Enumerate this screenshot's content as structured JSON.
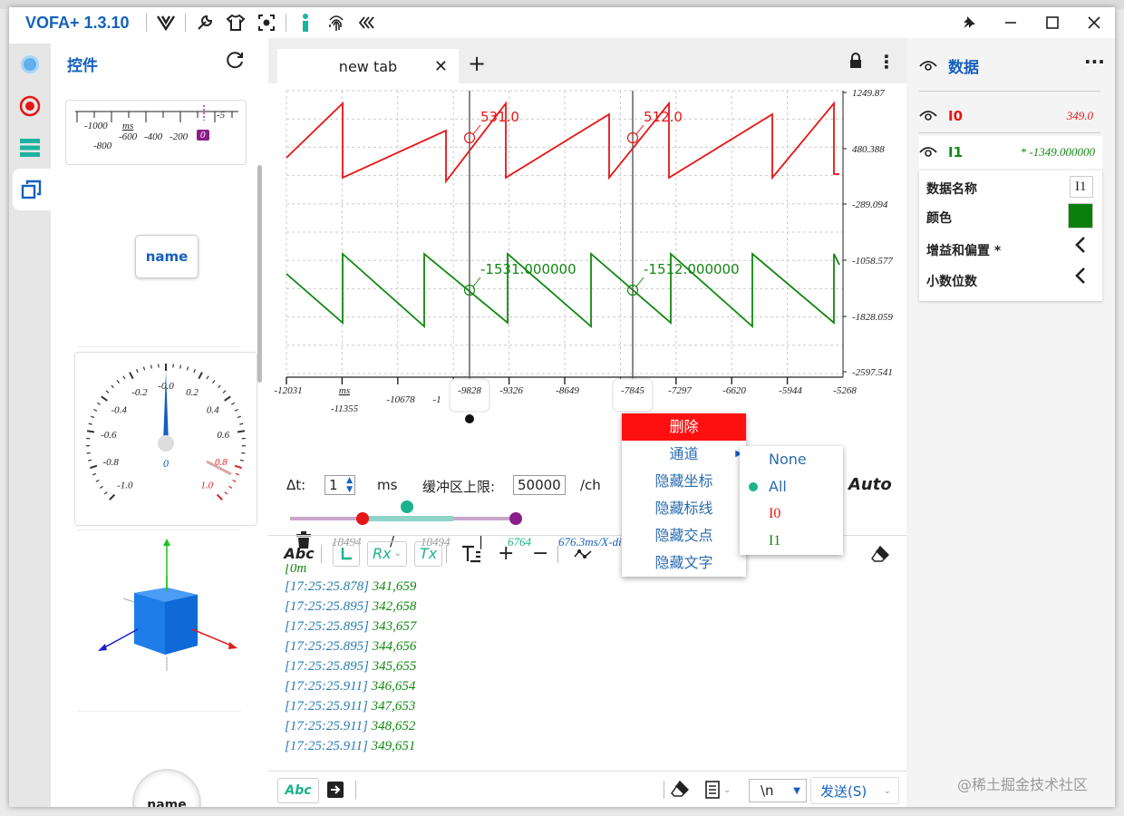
{
  "app": {
    "title": "VOFA+ 1.3.10"
  },
  "widgets": {
    "header": "控件",
    "name_button": "name",
    "name_knob": "name",
    "ruler_ticks": [
      "-1000",
      "-800",
      "-600",
      "-400",
      "-200"
    ],
    "ruler_unit": "ms",
    "ruler_edge": "-5",
    "ruler_badge": "0",
    "gauge_labels": [
      "-1.0",
      "-0.8",
      "-0.6",
      "-0.4",
      "-0.2",
      "-0.0",
      "0.2",
      "0.4",
      "0.6",
      "0.8",
      "1.0"
    ],
    "gauge_value": "0"
  },
  "tab": {
    "label": "new tab"
  },
  "plot": {
    "y_ticks": [
      "1249.87",
      "480.388",
      "-289.094",
      "-1058.577",
      "-1828.059",
      "-2597.541"
    ],
    "x_ticks_top": [
      "-12031",
      "-9828",
      "-9326",
      "-8649",
      "-7845",
      "-7297",
      "-6620",
      "-5944",
      "-5268"
    ],
    "x_ticks_bottom": [
      "-11355",
      "-10678",
      "-1"
    ],
    "x_unit": "ms",
    "cursor_labels": [
      {
        "text": "531.0",
        "color": "#e81515"
      },
      {
        "text": "512.0",
        "color": "#e81515"
      },
      {
        "text": "-1531.000000",
        "color": "#118811"
      },
      {
        "text": "-1512.000000",
        "color": "#118811"
      }
    ],
    "series": [
      {
        "name": "I0",
        "color": "#e81515"
      },
      {
        "name": "I1",
        "color": "#118811"
      }
    ]
  },
  "controls": {
    "dt_label": "Δt:",
    "dt_value": "1",
    "dt_unit": "ms",
    "buffer_label": "缓冲区上限:",
    "buffer_value": "50000",
    "buffer_unit": "/ch",
    "auto_label": "Auto",
    "stat1": "18494",
    "slash": "/",
    "stat2": "18494",
    "bar": "|",
    "stat3": "6764",
    "stat4": "676.3ms/X-div"
  },
  "toolbar2": {
    "abc": "Abc",
    "rx": "Rx",
    "tx": "Tx"
  },
  "log": {
    "first": "[0m",
    "lines": [
      {
        "ts": "[17:25:25.878]",
        "val": "341,659"
      },
      {
        "ts": "[17:25:25.895]",
        "val": "342,658"
      },
      {
        "ts": "[17:25:25.895]",
        "val": "343,657"
      },
      {
        "ts": "[17:25:25.895]",
        "val": "344,656"
      },
      {
        "ts": "[17:25:25.895]",
        "val": "345,655"
      },
      {
        "ts": "[17:25:25.911]",
        "val": "346,654"
      },
      {
        "ts": "[17:25:25.911]",
        "val": "347,653"
      },
      {
        "ts": "[17:25:25.911]",
        "val": "348,652"
      },
      {
        "ts": "[17:25:25.911]",
        "val": "349,651"
      }
    ]
  },
  "sendbar": {
    "abc": "Abc",
    "newline": "\\n",
    "send": "发送(S)"
  },
  "right": {
    "header": "数据",
    "channels": [
      {
        "name": "I0",
        "value": "349.0",
        "color": "#e81515"
      },
      {
        "name": "I1",
        "value": "* -1349.000000",
        "color": "#118811"
      }
    ],
    "props": {
      "name_label": "数据名称",
      "name_value": "I1",
      "color_label": "颜色",
      "color_value": "#0a800a",
      "gain_label": "增益和偏置 *",
      "decimal_label": "小数位数"
    }
  },
  "context_menu": {
    "items": [
      "删除",
      "通道",
      "隐藏坐标",
      "隐藏标线",
      "隐藏交点",
      "隐藏文字"
    ],
    "sub_items": [
      {
        "label": "None",
        "color": "#2a6cb0"
      },
      {
        "label": "All",
        "color": "#2a6cb0"
      },
      {
        "label": "I0",
        "color": "#e81515"
      },
      {
        "label": "I1",
        "color": "#118811"
      }
    ],
    "sub_selected": "All"
  },
  "watermark": "@稀土掘金技术社区"
}
